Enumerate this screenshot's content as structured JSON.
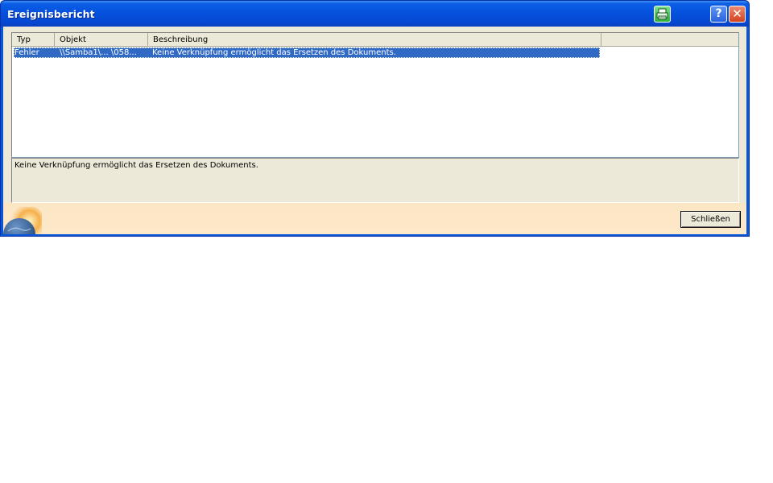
{
  "window": {
    "title": "Ereignisbericht"
  },
  "titlebar": {
    "print_icon": "printer-icon",
    "help_label": "?",
    "close_label": "✕"
  },
  "list": {
    "columns": [
      "Typ",
      "Objekt",
      "Beschreibung"
    ],
    "rows": [
      {
        "typ": "Fehler",
        "objekt": "\\\\Samba1\\... \\058...",
        "beschreibung": "Keine Verknüpfung ermöglicht das Ersetzen des Dokuments.",
        "selected": true
      }
    ]
  },
  "detail": {
    "text": "Keine Verknüpfung ermöglicht das Ersetzen des Dokuments."
  },
  "footer": {
    "close_button_label": "Schließen",
    "decoration_icon": "globe-icon"
  },
  "colors": {
    "titlebar": "#0550dc",
    "selection": "#316ac5",
    "dialog_bg": "#ece9d8",
    "footer_bg": "#fde9c9"
  }
}
